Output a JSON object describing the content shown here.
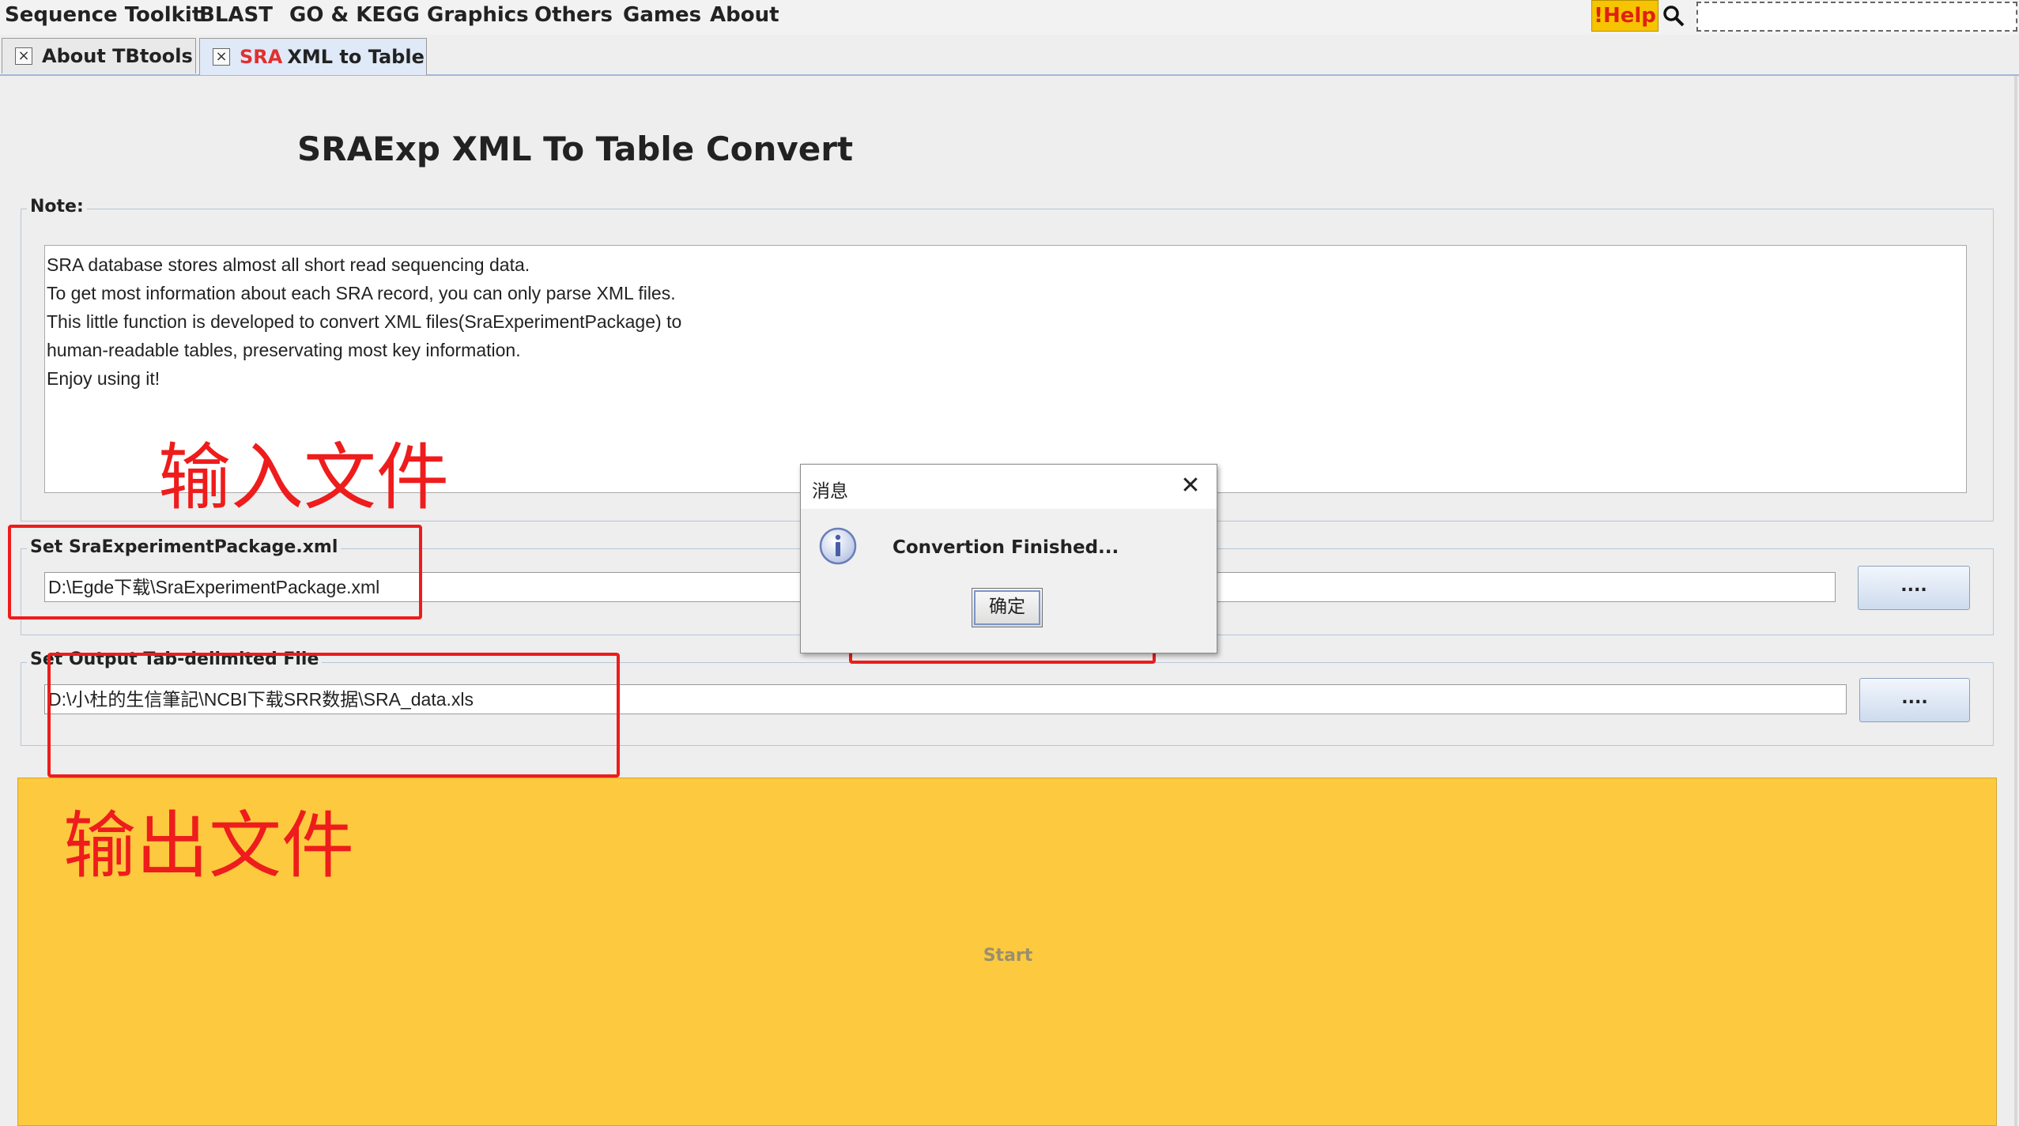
{
  "menubar": {
    "items": [
      "Sequence Toolkit",
      "BLAST",
      "GO & KEGG",
      "Graphics",
      "Others",
      "Games",
      "About"
    ],
    "help_label": "!Help"
  },
  "tabs": [
    {
      "label": "About TBtools",
      "prefix": ""
    },
    {
      "label": "XML to Table",
      "prefix": "SRA"
    }
  ],
  "main": {
    "title": "SRAExp XML To Table Convert",
    "note": {
      "title": "Note:",
      "lines": [
        "SRA database stores almost all short read sequencing data.",
        "To get most information about each SRA record, you can only parse XML files.",
        "This little function is developed to convert XML files(SraExperimentPackage) to",
        "human-readable tables, preservating most key information.",
        "Enjoy using it!"
      ]
    },
    "input_group": {
      "title": "Set SraExperimentPackage.xml",
      "value": "D:\\Egde下载\\SraExperimentPackage.xml",
      "browse_label": "...."
    },
    "output_group": {
      "title": "Set Output Tab-delimited File",
      "value": "D:\\小杜的生信筆記\\NCBI下载SRR数据\\SRA_data.xls",
      "browse_label": "...."
    },
    "start_label": "Start"
  },
  "annotations": {
    "input_label": "输入文件",
    "output_label": "输出文件"
  },
  "dialog": {
    "title": "消息",
    "message": "Convertion Finished...",
    "ok_label": "确定"
  },
  "colors": {
    "start_panel": "#fcc93f",
    "annotation_red": "#ee1c1c",
    "help_yellow": "#f6c400"
  }
}
